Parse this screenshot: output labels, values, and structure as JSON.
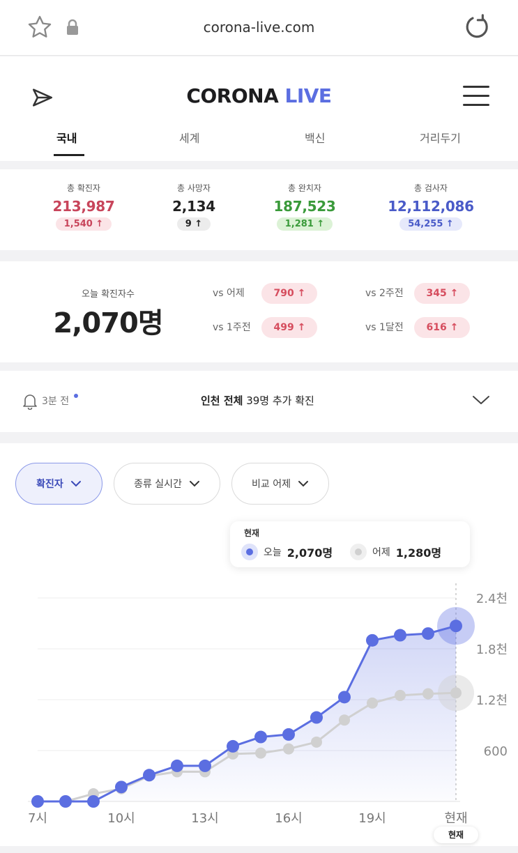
{
  "browser": {
    "url": "corona-live.com"
  },
  "header": {
    "logo_a": "CORONA",
    "logo_b": "LIVE"
  },
  "tabs": [
    "국내",
    "세계",
    "백신",
    "거리두기"
  ],
  "stats": [
    {
      "label": "총 확진자",
      "value": "213,987",
      "change": "1,540 ↑",
      "color": "#c8455b",
      "bg": "#fbe4e7"
    },
    {
      "label": "총 사망자",
      "value": "2,134",
      "change": "9 ↑",
      "color": "#222222",
      "bg": "#ececec"
    },
    {
      "label": "총 완치자",
      "value": "187,523",
      "change": "1,281 ↑",
      "color": "#3a9a3a",
      "bg": "#dcf2d6"
    },
    {
      "label": "총 검사자",
      "value": "12,112,086",
      "change": "54,255 ↑",
      "color": "#4a5bc8",
      "bg": "#e6e9fb"
    }
  ],
  "today": {
    "label": "오늘 확진자수",
    "value": "2,070명",
    "comparisons": [
      {
        "label": "vs 어제",
        "value": "790 ↑"
      },
      {
        "label": "vs 2주전",
        "value": "345 ↑"
      },
      {
        "label": "vs 1주전",
        "value": "499 ↑"
      },
      {
        "label": "vs 1달전",
        "value": "616 ↑"
      }
    ]
  },
  "notice": {
    "time": "3분 전",
    "region": "인천 전체",
    "message": "39명 추가 확진"
  },
  "filters": {
    "type": "확진자",
    "kind": "종류 실시간",
    "compare": "비교 어제"
  },
  "tooltip": {
    "title": "현재",
    "today_label": "오늘",
    "today_value": "2,070명",
    "yesterday_label": "어제",
    "yesterday_value": "1,280명"
  },
  "chart_data": {
    "type": "area",
    "x": [
      "7시",
      "8시",
      "9시",
      "10시",
      "11시",
      "12시",
      "13시",
      "14시",
      "15시",
      "16시",
      "17시",
      "18시",
      "19시",
      "20시",
      "21시",
      "현재"
    ],
    "x_tick_labels": [
      "7시",
      "10시",
      "13시",
      "16시",
      "19시",
      "현재"
    ],
    "y_tick_labels": [
      "600",
      "1.2천",
      "1.8천",
      "2.4천"
    ],
    "ylim": [
      0,
      2400
    ],
    "series": [
      {
        "name": "오늘",
        "color": "#5b6ee1",
        "values": [
          0,
          0,
          0,
          170,
          310,
          420,
          420,
          650,
          760,
          790,
          990,
          1230,
          1900,
          1960,
          1980,
          2070
        ]
      },
      {
        "name": "어제",
        "color": "#d0d0d0",
        "values": [
          0,
          0,
          90,
          150,
          300,
          350,
          350,
          560,
          570,
          620,
          700,
          960,
          1160,
          1250,
          1270,
          1280
        ]
      }
    ],
    "grid": true
  },
  "chart_current_tag": "현재",
  "colors": {
    "accent": "#5b6ee1",
    "up": "#d64d5e",
    "background": "#f2f2f4"
  }
}
